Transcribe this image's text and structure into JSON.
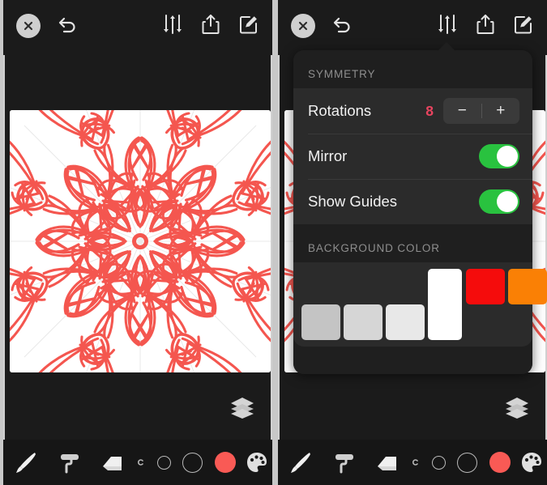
{
  "app": {
    "name": "symmetry-drawing-app",
    "accent_red": "#f4564f",
    "accent_pink": "#e8445f",
    "toggle_green": "#29c23f",
    "panel_bg": "#1b1b1b",
    "popover_bg": "#1f1f1f",
    "row_bg": "#2b2b2b"
  },
  "topbar": {
    "close_label": "×",
    "icons": [
      {
        "name": "close-icon",
        "label": "Close"
      },
      {
        "name": "undo-icon",
        "label": "Undo"
      },
      {
        "name": "sliders-icon",
        "label": "Settings"
      },
      {
        "name": "share-icon",
        "label": "Share"
      },
      {
        "name": "edit-icon",
        "label": "Edit"
      }
    ]
  },
  "canvas": {
    "name": "drawing-canvas",
    "background": "#ffffff",
    "stroke_color": "#f4564f",
    "guide_color": "#e8e8e8",
    "rotations": 8,
    "mirror": true,
    "show_guides": true
  },
  "layers": {
    "name": "layers-button",
    "label": "Layers"
  },
  "bottombar": {
    "tools": [
      {
        "name": "brush-tool",
        "label": "Brush"
      },
      {
        "name": "roller-tool",
        "label": "Roller"
      },
      {
        "name": "eraser-tool",
        "label": "Eraser"
      },
      {
        "name": "size-tiny",
        "label": "Tiny size"
      },
      {
        "name": "size-small",
        "label": "Small size"
      },
      {
        "name": "size-medium",
        "label": "Medium size"
      },
      {
        "name": "size-large",
        "label": "Large size"
      },
      {
        "name": "current-color-swatch",
        "label": "Current color",
        "color": "#f95a55"
      },
      {
        "name": "palette-tool",
        "label": "Palette"
      }
    ]
  },
  "popover": {
    "symmetry": {
      "header": "SYMMETRY",
      "rows": [
        {
          "label": "Rotations",
          "value": "8",
          "control": "stepper",
          "minus": "−",
          "plus": "+"
        },
        {
          "label": "Mirror",
          "value": "on",
          "control": "toggle"
        },
        {
          "label": "Show Guides",
          "value": "on",
          "control": "toggle"
        }
      ]
    },
    "background_color": {
      "header": "BACKGROUND COLOR",
      "selected": "#ffffff",
      "swatches": [
        {
          "name": "swatch-gray-1",
          "color": "#c4c4c4",
          "row": "bottom"
        },
        {
          "name": "swatch-gray-2",
          "color": "#d6d6d6",
          "row": "bottom"
        },
        {
          "name": "swatch-gray-3",
          "color": "#e8e8e8",
          "row": "bottom"
        },
        {
          "name": "swatch-white-selected",
          "color": "#ffffff",
          "row": "tall"
        },
        {
          "name": "swatch-red",
          "color": "#f50c0c",
          "row": "top"
        },
        {
          "name": "swatch-orange",
          "color": "#fa8005",
          "row": "top"
        },
        {
          "name": "swatch-yellow",
          "color": "#f8f406",
          "row": "top"
        }
      ]
    }
  }
}
